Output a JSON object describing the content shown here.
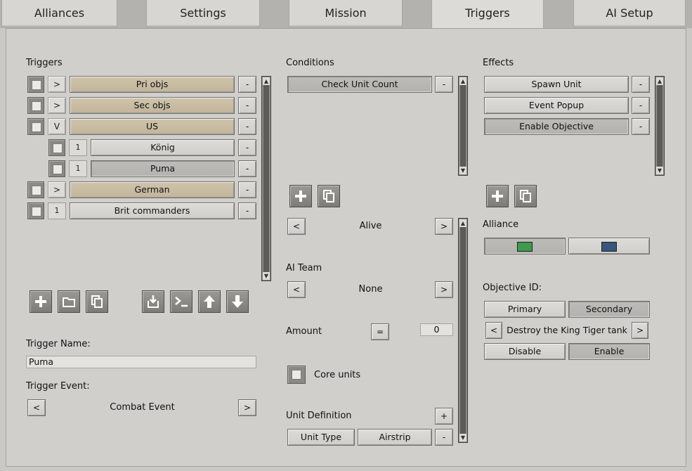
{
  "tabs": [
    "Alliances",
    "Settings",
    "Mission",
    "Triggers",
    "AI Setup"
  ],
  "triggers": {
    "heading": "Triggers",
    "items": [
      {
        "toggle": ">",
        "label": "Pri objs",
        "remove": "-"
      },
      {
        "toggle": ">",
        "label": "Sec objs",
        "remove": "-"
      },
      {
        "toggle": "V",
        "label": "US",
        "remove": "-"
      },
      {
        "toggle": "1",
        "label": "König",
        "remove": "-"
      },
      {
        "toggle": "1",
        "label": "Puma",
        "remove": "-"
      },
      {
        "toggle": ">",
        "label": "German",
        "remove": "-"
      },
      {
        "toggle": "1",
        "label": "Brit commanders",
        "remove": "-"
      }
    ],
    "name_label": "Trigger Name:",
    "name_value": "Puma",
    "event_label": "Trigger Event:",
    "event_value": "Combat Event",
    "prev": "<",
    "next": ">",
    "toolbar_icons": [
      "plus-icon",
      "folder-icon",
      "copy-icon",
      "import-icon",
      "terminal-icon",
      "arrow-up-icon",
      "arrow-down-icon"
    ]
  },
  "conditions": {
    "heading": "Conditions",
    "items": [
      {
        "label": "Check Unit Count",
        "remove": "-"
      }
    ],
    "state_prev": "<",
    "state_value": "Alive",
    "state_next": ">",
    "ai_team_label": "AI Team",
    "ai_team_prev": "<",
    "ai_team_value": "None",
    "ai_team_next": ">",
    "amount_label": "Amount",
    "amount_op": "=",
    "amount_value": "0",
    "core_units_label": "Core units",
    "unit_def_label": "Unit Definition",
    "unit_def_add": "+",
    "unit_type": "Unit Type",
    "unit_value": "Airstrip",
    "unit_remove": "-"
  },
  "effects": {
    "heading": "Effects",
    "items": [
      {
        "label": "Spawn Unit",
        "remove": "-"
      },
      {
        "label": "Event Popup",
        "remove": "-"
      },
      {
        "label": "Enable Objective",
        "remove": "-"
      }
    ],
    "alliance_label": "Alliance",
    "alliance_colors": [
      "#3f9a4e",
      "#38567e"
    ],
    "objective_label": "Objective ID:",
    "primary": "Primary",
    "secondary": "Secondary",
    "obj_prev": "<",
    "objective": "Destroy the King Tiger tank",
    "obj_next": ">",
    "disable": "Disable",
    "enable": "Enable"
  }
}
